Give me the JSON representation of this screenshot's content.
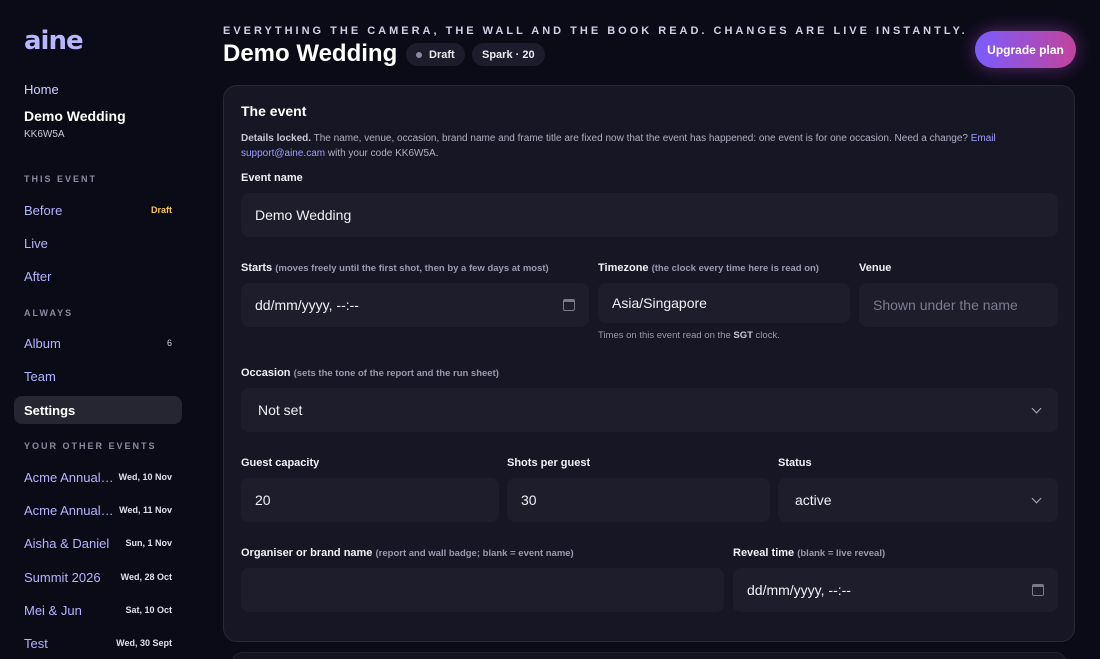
{
  "brand": {
    "logo": "aine"
  },
  "sidebar": {
    "home": "Home",
    "event_title": "Demo Wedding",
    "event_code": "KK6W5A",
    "this_event_label": "THIS EVENT",
    "this_event_items": [
      {
        "label": "Before",
        "badge": "Draft"
      },
      {
        "label": "Live"
      },
      {
        "label": "After"
      }
    ],
    "always_label": "ALWAYS",
    "always_items": [
      {
        "label": "Album",
        "count": "6"
      },
      {
        "label": "Team"
      },
      {
        "label": "Settings"
      }
    ],
    "other_label": "YOUR OTHER EVENTS",
    "other_events": [
      {
        "name": "Acme Annual Summit",
        "date": "Wed, 10 Nov"
      },
      {
        "name": "Acme Annual Summit",
        "date": "Wed, 11 Nov"
      },
      {
        "name": "Aisha & Daniel",
        "date": "Sun, 1 Nov"
      },
      {
        "name": "Summit 2026",
        "date": "Wed, 28 Oct"
      },
      {
        "name": "Mei & Jun",
        "date": "Sat, 10 Oct"
      },
      {
        "name": "Test",
        "date": "Wed, 30 Sept"
      }
    ]
  },
  "header": {
    "tagline": "EVERYTHING THE CAMERA, THE WALL AND THE BOOK READ. CHANGES ARE LIVE INSTANTLY.",
    "title": "Demo Wedding",
    "status_pill": "Draft",
    "plan_pill": "Spark · 20",
    "upgrade_label": "Upgrade plan"
  },
  "card": {
    "title": "The event",
    "notice_bold": "Details locked.",
    "notice_text": " The name, venue, occasion, brand name and frame title are fixed now that the event has happened: one event is for one occasion. Need a change? ",
    "notice_link": "Email support@aine.cam",
    "notice_tail": " with your code KK6W5A.",
    "event_name_label": "Event name",
    "event_name_value": "Demo Wedding",
    "starts_label": "Starts",
    "starts_hint": "(moves freely until the first shot, then by a few days at most)",
    "starts_value": "dd/mm/yyyy, --:--",
    "timezone_label": "Timezone",
    "timezone_hint": "(the clock every time here is read on)",
    "timezone_value": "Asia/Singapore",
    "timezone_help_pre": "Times on this event read on the ",
    "timezone_help_code": "SGT",
    "timezone_help_post": " clock.",
    "venue_label": "Venue",
    "venue_placeholder": "Shown under the name",
    "occasion_label": "Occasion",
    "occasion_hint": "(sets the tone of the report and the run sheet)",
    "occasion_value": "Not set",
    "capacity_label": "Guest capacity",
    "capacity_value": "20",
    "shots_label": "Shots per guest",
    "shots_value": "30",
    "status_label": "Status",
    "status_value": "active",
    "organiser_label": "Organiser or brand name",
    "organiser_hint": "(report and wall badge; blank = event name)",
    "organiser_value": "",
    "reveal_label": "Reveal time",
    "reveal_hint": "(blank = live reveal)",
    "reveal_value": "dd/mm/yyyy, --:--"
  },
  "colors": {
    "accent": "#b4b4ff",
    "badge": "#f5c84c",
    "upgrade_start": "#7b5cff",
    "upgrade_end": "#c2439a"
  }
}
